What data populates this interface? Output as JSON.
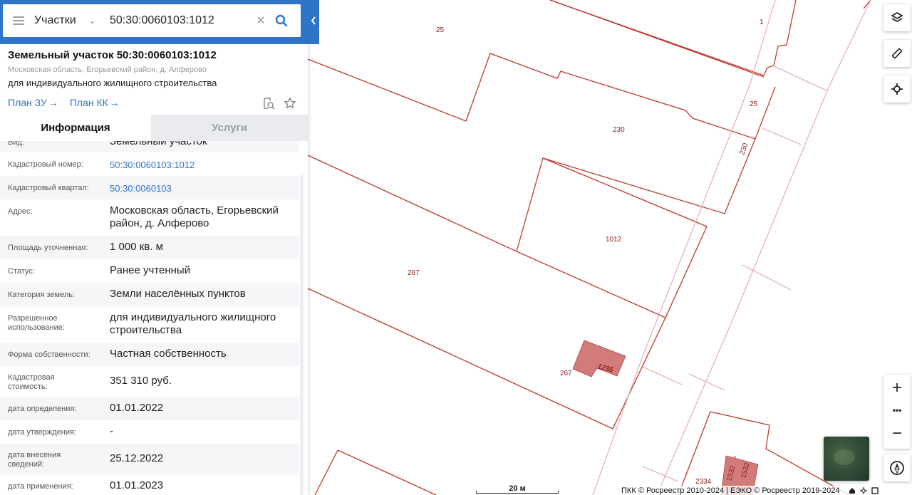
{
  "search": {
    "layer": "Участки",
    "value": "50:30:0060103:1012",
    "clear_icon": "close-icon",
    "search_icon": "search-icon"
  },
  "header": {
    "title": "Земельный участок 50:30:0060103:1012",
    "address_sub": "Московская область, Егорьевский район, д. Алферово",
    "purpose": "для индивидуального жилищного строительства",
    "plan_zu": "План ЗУ",
    "plan_kk": "План КК"
  },
  "tabs": [
    {
      "label": "Информация",
      "active": true
    },
    {
      "label": "Услуги",
      "active": false
    }
  ],
  "info_rows": [
    {
      "label": "Вид:",
      "value": "Земельный участок"
    },
    {
      "label": "Кадастровый номер:",
      "value": "50:30:0060103:1012",
      "link": true
    },
    {
      "label": "Кадастровый квартал:",
      "value": "50:30:0060103",
      "link": true
    },
    {
      "label": "Адрес:",
      "value": "Московская область, Егорьевский район, д. Алферово"
    },
    {
      "label": "Площадь уточненная:",
      "value": "1 000 кв. м"
    },
    {
      "label": "Статус:",
      "value": "Ранее учтенный"
    },
    {
      "label": "Категория земель:",
      "value": "Земли населённых пунктов"
    },
    {
      "label": "Разрешенное использование:",
      "value": "для индивидуального жилищного строительства"
    },
    {
      "label": "Форма собственности:",
      "value": "Частная собственность"
    },
    {
      "label": "Кадастровая стоимость:",
      "value": "351 310 руб."
    },
    {
      "label": "дата определения:",
      "value": "01.01.2022"
    },
    {
      "label": "дата утверждения:",
      "value": "-"
    },
    {
      "label": "дата внесения сведений:",
      "value": "25.12.2022"
    },
    {
      "label": "дата применения:",
      "value": "01.01.2023"
    }
  ],
  "map": {
    "parcel_labels": [
      "25",
      "1",
      "25",
      "230",
      "230",
      "1012",
      "267",
      "267",
      "1235",
      "2334",
      "1532",
      "1532"
    ],
    "scale_label": "20 м",
    "attribution": "ПКК © Росреестр 2010-2024 | ЕЭКО © Росреестр 2019-2024",
    "controls": {
      "layers": "layers-icon",
      "measure": "ruler-icon",
      "locate": "crosshair-icon",
      "zoom_in": "+",
      "more": "•••",
      "zoom_out": "−",
      "compass": "compass-icon"
    },
    "colors": {
      "parcel_stroke": "#c0392b",
      "building_fill": "#d27b7b",
      "accent": "#2e75c9"
    }
  }
}
